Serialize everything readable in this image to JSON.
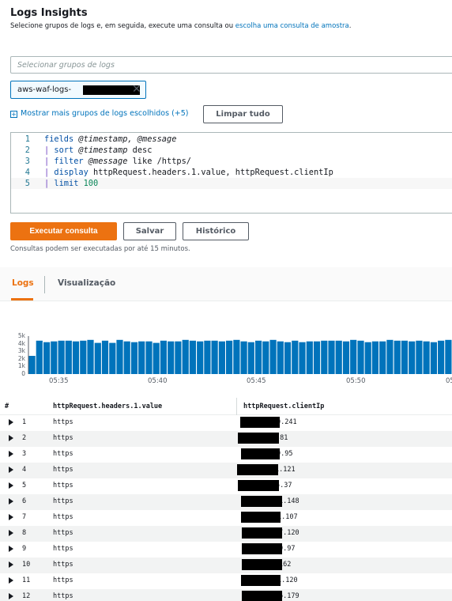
{
  "header": {
    "title": "Logs Insights",
    "subtitle_text": "Selecione grupos de logs e, em seguida, execute uma consulta ou ",
    "subtitle_link": "escolha uma consulta de amostra",
    "subtitle_end": "."
  },
  "log_group_select": {
    "placeholder": "Selecionar grupos de logs"
  },
  "selected_group": {
    "label": "aws-waf-logs-"
  },
  "more_groups_link": "Mostrar mais grupos de logs escolhidos (+5)",
  "clear_all_button": "Limpar tudo",
  "query": {
    "line_numbers": [
      "1",
      "2",
      "3",
      "4",
      "5"
    ],
    "lines": [
      {
        "pipe": "",
        "command": "fields",
        "rest_italic": " @timestamp, @message",
        "rest": ""
      },
      {
        "pipe": "| ",
        "command": "sort",
        "rest_italic": " @timestamp",
        "rest": " desc"
      },
      {
        "pipe": "| ",
        "command": "filter",
        "rest_italic": " @message",
        "rest": " like /https/"
      },
      {
        "pipe": "| ",
        "command": "display",
        "rest_italic": "",
        "rest": " httpRequest.headers.1.value, httpRequest.clientIp"
      },
      {
        "pipe": "| ",
        "command": "limit",
        "rest_italic": "",
        "rest": " ",
        "number": "100"
      }
    ]
  },
  "buttons": {
    "run": "Executar consulta",
    "save": "Salvar",
    "history": "Histórico"
  },
  "hint": "Consultas podem ser executadas por até 15 minutos.",
  "tabs": {
    "logs": "Logs",
    "visualization": "Visualização"
  },
  "chart_data": {
    "type": "bar",
    "title": "",
    "xlabel": "",
    "ylabel": "",
    "y_ticks": [
      "5k",
      "4k",
      "3k",
      "2k",
      "1k",
      "0"
    ],
    "x_ticks": [
      "05:35",
      "05:40",
      "05:45",
      "05:50",
      "05"
    ],
    "ylim": [
      0,
      5000
    ],
    "values": [
      2400,
      4400,
      4200,
      4300,
      4400,
      4400,
      4300,
      4400,
      4500,
      4100,
      4400,
      4100,
      4500,
      4300,
      4200,
      4300,
      4300,
      4100,
      4400,
      4300,
      4300,
      4500,
      4400,
      4300,
      4400,
      4400,
      4300,
      4400,
      4500,
      4300,
      4200,
      4400,
      4300,
      4500,
      4300,
      4200,
      4400,
      4200,
      4300,
      4300,
      4400,
      4400,
      4400,
      4300,
      4500,
      4400,
      4200,
      4300,
      4300,
      4500,
      4400,
      4400,
      4300,
      4400,
      4300,
      4200,
      4400,
      4500
    ],
    "color": "#0073bb",
    "grid": false
  },
  "table": {
    "headers": {
      "index": "#",
      "col1": "httpRequest.headers.1.value",
      "col2": "httpRequest.clientIp"
    },
    "rows": [
      {
        "index": "1",
        "value": "https",
        "ip_suffix": "0.241"
      },
      {
        "index": "2",
        "value": "https",
        "ip_suffix": ".81"
      },
      {
        "index": "3",
        "value": "https",
        "ip_suffix": "9.95"
      },
      {
        "index": "4",
        "value": "https",
        "ip_suffix": "1.121"
      },
      {
        "index": "5",
        "value": "https",
        "ip_suffix": "5.37"
      },
      {
        "index": "6",
        "value": "https",
        "ip_suffix": "1.148"
      },
      {
        "index": "7",
        "value": "https",
        "ip_suffix": "1.107"
      },
      {
        "index": "8",
        "value": "https",
        "ip_suffix": "7.120"
      },
      {
        "index": "9",
        "value": "https",
        "ip_suffix": "9.97"
      },
      {
        "index": "10",
        "value": "https",
        "ip_suffix": "162"
      },
      {
        "index": "11",
        "value": "https",
        "ip_suffix": "1.120"
      },
      {
        "index": "12",
        "value": "https",
        "ip_suffix": "6.179"
      }
    ]
  }
}
